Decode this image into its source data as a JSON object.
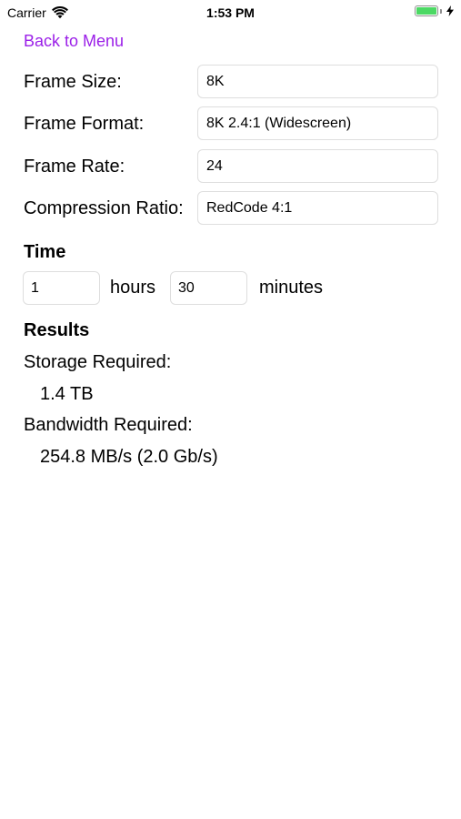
{
  "status_bar": {
    "carrier": "Carrier",
    "time": "1:53 PM",
    "battery_level": 1.0,
    "battery_color": "#4cd964",
    "icons": [
      "wifi-icon",
      "battery-icon",
      "charging-bolt-icon"
    ]
  },
  "nav": {
    "back_label": "Back to Menu",
    "accent_color": "#9b1fe8"
  },
  "form": {
    "frame_size": {
      "label": "Frame Size:",
      "value": "8K"
    },
    "frame_format": {
      "label": "Frame Format:",
      "value": "8K 2.4:1 (Widescreen)"
    },
    "frame_rate": {
      "label": "Frame Rate:",
      "value": "24"
    },
    "compression": {
      "label": "Compression Ratio:",
      "value": "RedCode 4:1"
    }
  },
  "time": {
    "heading": "Time",
    "hours_value": "1",
    "hours_label": "hours",
    "minutes_value": "30",
    "minutes_label": "minutes"
  },
  "results": {
    "heading": "Results",
    "storage_label": "Storage Required:",
    "storage_value": "1.4 TB",
    "bandwidth_label": "Bandwidth Required:",
    "bandwidth_value": "254.8 MB/s (2.0 Gb/s)"
  }
}
